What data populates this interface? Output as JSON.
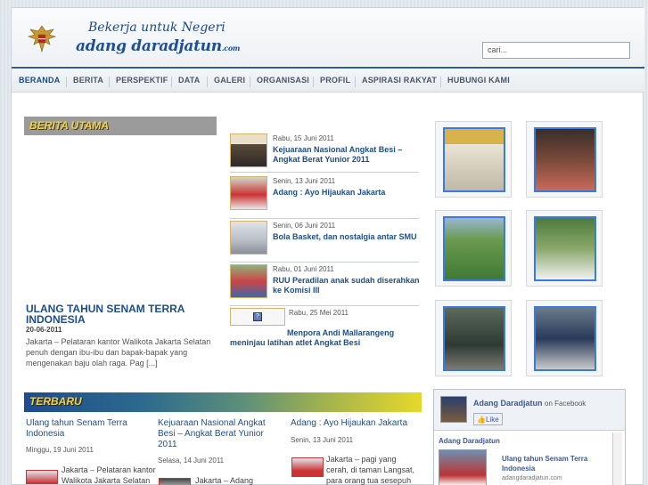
{
  "header": {
    "tagline": "Bekerja untuk Negeri",
    "logo": "adang daradjatun",
    "logo_suffix": ".com",
    "search_placeholder": "cari..."
  },
  "nav": [
    "BERANDA",
    "BERITA",
    "PERSPEKTIF",
    "DATA",
    "GALERI",
    "ORGANISASI",
    "PROFIL",
    "ASPIRASI RAKYAT",
    "HUBUNGI KAMI"
  ],
  "berita_utama": {
    "heading": "BERITA UTAMA",
    "featured": {
      "title": "ULANG TAHUN SENAM TERRA INDONESIA",
      "date": "20-06-2011",
      "excerpt": "Jakarta – Pelataran kantor Walikota Jakarta Selatan penuh dengan ibu-ibu dan bapak-bapak yang mengenakan baju olah raga. Pag [...]"
    },
    "list": [
      {
        "date": "Rabu, 15 Juni 2011",
        "title": "Kejuaraan Nasional Angkat Besi – Angkat Berat Yunior 2011"
      },
      {
        "date": "Senin, 13 Juni 2011",
        "title": "Adang : Ayo Hijaukan Jakarta"
      },
      {
        "date": "Senin, 06 Juni 2011",
        "title": "Bola Basket, dan nostalgia antar SMU"
      },
      {
        "date": "Rabu, 01 Juni 2011",
        "title": "RUU Peradilan anak sudah diserahkan ke Komisi III"
      },
      {
        "date": "Rabu, 25 Mei 2011",
        "title": "Menpora Andi Mallarangeng meninjau latihan atlet Angkat Besi"
      }
    ]
  },
  "terbaru": {
    "heading": "TERBARU",
    "items": [
      {
        "title": "Ulang tahun Senam Terra Indonesia",
        "date": "Minggu, 19 Juni 2011",
        "text": "Jakarta – Pelataran kantor Walikota Jakarta Selatan"
      },
      {
        "title": "Kejuaraan Nasional Angkat Besi – Angkat Berat Yunior 2011",
        "date": "Selasa, 14 Juni 2011",
        "text": "Jakarta – Adang"
      },
      {
        "title": "Adang : Ayo Hijaukan Jakarta",
        "date": "Senin, 13 Juni 2011",
        "text": "Jakarta – pagi yang cerah, di taman Langsat, para orang tua sesepuh"
      }
    ]
  },
  "facebook": {
    "name": "Adang Daradjatun",
    "on": "on Facebook",
    "like": "Like",
    "page": "Adang Daradjatun",
    "post_title": "Ulang tahun Senam Terra Indonesia",
    "post_src": "adangdaradjatun.com"
  },
  "colors": {
    "brand": "#1e4f98",
    "nav_accent": "#2a5fa8",
    "heading_yellow": "#f6d23a"
  }
}
